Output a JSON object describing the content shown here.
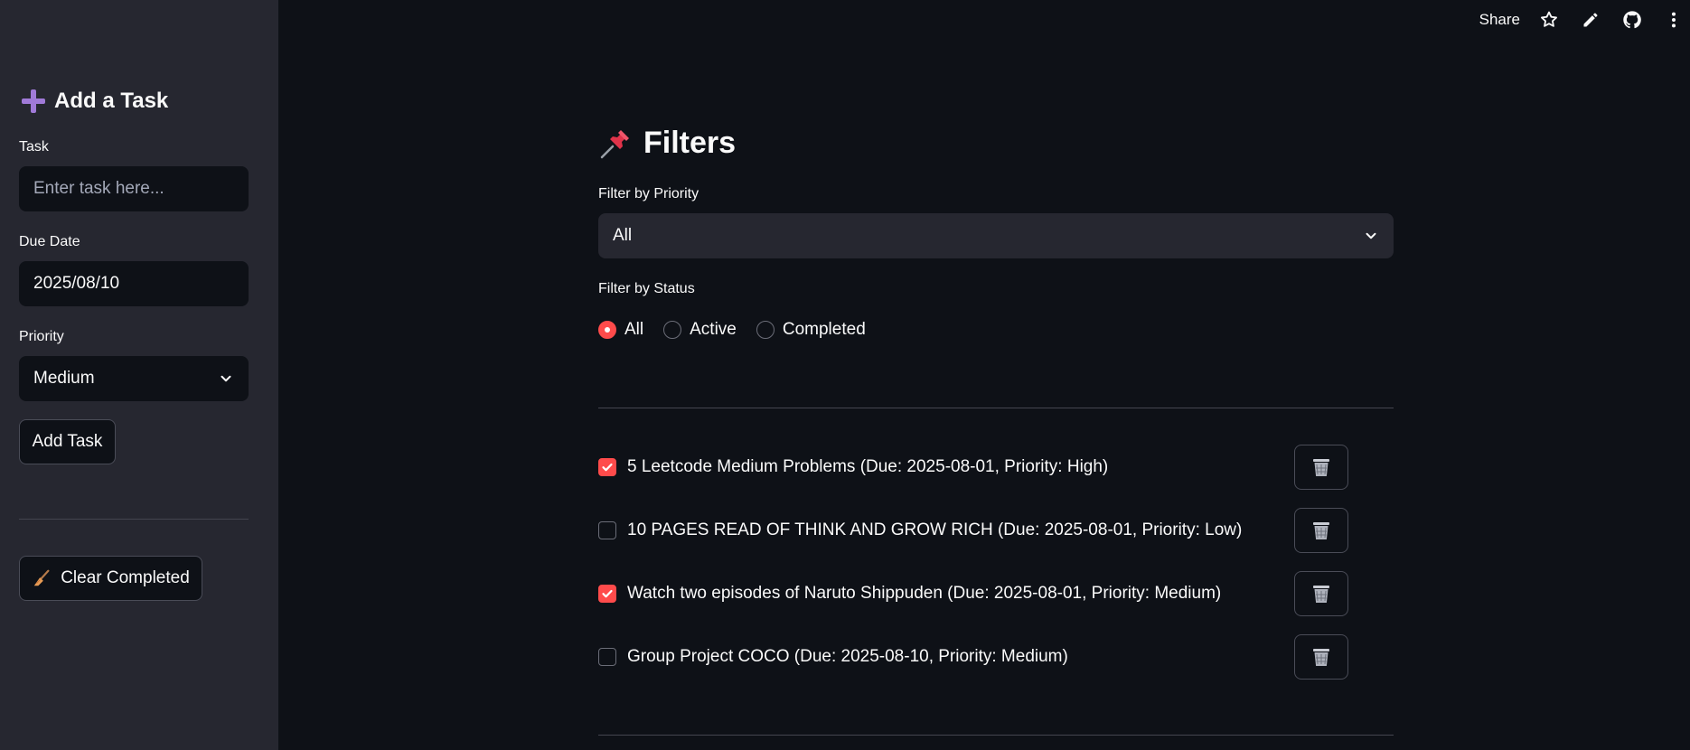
{
  "toolbar": {
    "share_label": "Share",
    "icons": [
      "star-icon",
      "pencil-icon",
      "github-icon",
      "more-vertical-icon"
    ]
  },
  "sidebar": {
    "title": "Add a Task",
    "title_icon": "plus-icon",
    "task": {
      "label": "Task",
      "placeholder": "Enter task here...",
      "value": ""
    },
    "due_date": {
      "label": "Due Date",
      "value": "2025/08/10"
    },
    "priority": {
      "label": "Priority",
      "value": "Medium"
    },
    "add_button": "Add Task",
    "clear_button": "Clear Completed",
    "clear_icon": "broom-icon"
  },
  "main": {
    "title": "Filters",
    "title_icon": "pushpin-icon",
    "priority_filter": {
      "label": "Filter by Priority",
      "value": "All"
    },
    "status_filter": {
      "label": "Filter by Status",
      "options": [
        {
          "label": "All",
          "selected": true
        },
        {
          "label": "Active",
          "selected": false
        },
        {
          "label": "Completed",
          "selected": false
        }
      ]
    },
    "tasks": [
      {
        "text": "5 Leetcode Medium Problems (Due: 2025-08-01, Priority: High)",
        "done": true
      },
      {
        "text": "10 PAGES READ OF THINK AND GROW RICH (Due: 2025-08-01, Priority: Low)",
        "done": false
      },
      {
        "text": "Watch two episodes of Naruto Shippuden (Due: 2025-08-01, Priority: Medium)",
        "done": true
      },
      {
        "text": "Group Project COCO (Due: 2025-08-10, Priority: Medium)",
        "done": false
      }
    ]
  },
  "colors": {
    "background": "#0e1117",
    "sidebar": "#262730",
    "accent": "#ff4b4b",
    "text": "#fafafa"
  }
}
